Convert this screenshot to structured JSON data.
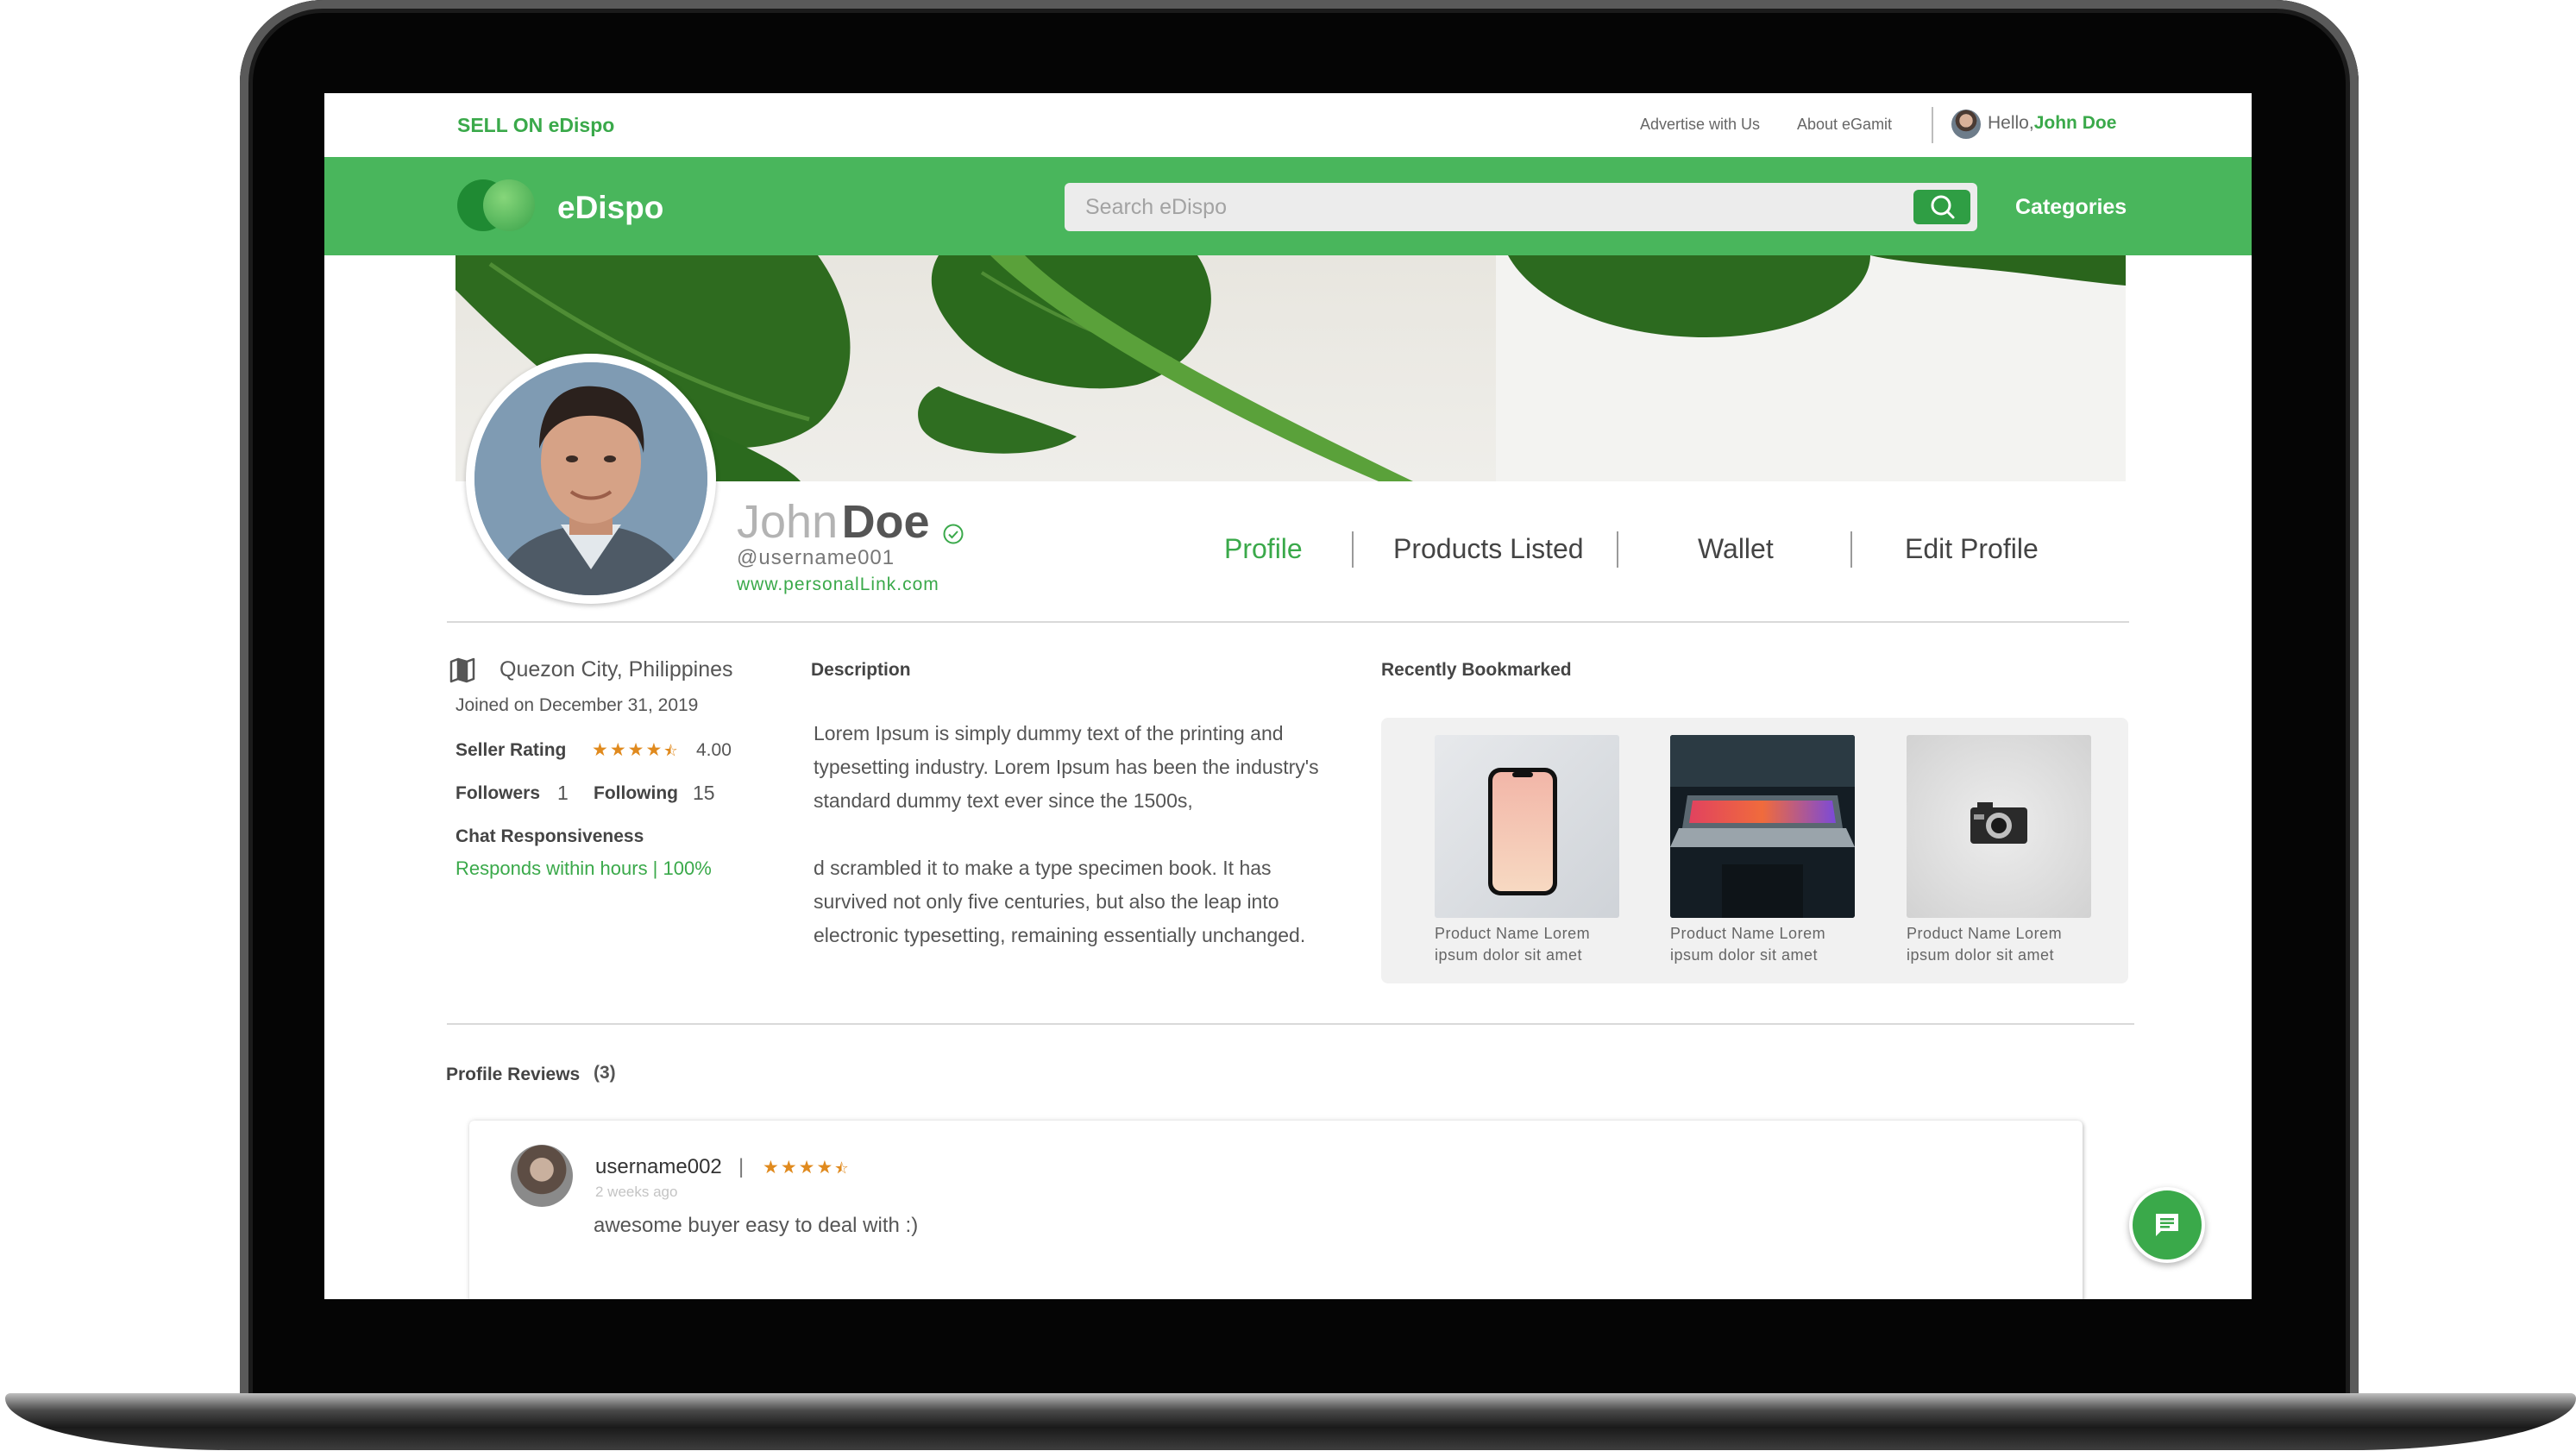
{
  "topbar": {
    "sell_link": "SELL ON eDispo",
    "advertise_link": "Advertise with Us",
    "about_link": "About eGamit",
    "greeting": "Hello,",
    "user_name": "John Doe"
  },
  "navbar": {
    "logo_text": "eDispo",
    "search_placeholder": "Search eDispo",
    "search_icon": "search-icon",
    "categories_label": "Categories"
  },
  "profile": {
    "first_name": "John",
    "last_name": "Doe",
    "username": "@username001",
    "personal_link": "www.personalLink.com",
    "verified_icon": "check-circle-icon"
  },
  "tabs": [
    {
      "label": "Profile",
      "active": true
    },
    {
      "label": "Products Listed",
      "active": false
    },
    {
      "label": "Wallet",
      "active": false
    },
    {
      "label": "Edit Profile",
      "active": false
    }
  ],
  "info": {
    "location_icon": "map-icon",
    "location": "Quezon City, Philippines",
    "joined": "Joined on December 31, 2019",
    "seller_rating_label": "Seller Rating",
    "seller_rating_stars": 4.5,
    "seller_rating_value": "4.00",
    "followers_label": "Followers",
    "followers_count": "1",
    "following_label": "Following",
    "following_count": "15",
    "chat_label": "Chat Responsiveness",
    "chat_value": "Responds within hours | 100%"
  },
  "description": {
    "title": "Description",
    "paragraph_1": "Lorem Ipsum is simply dummy text of the printing and typesetting industry. Lorem Ipsum has been the industry's standard dummy text ever since the 1500s,",
    "paragraph_2": "d scrambled it to make a type specimen book. It has survived not only five centuries, but also the leap into electronic typesetting, remaining essentially unchanged."
  },
  "bookmarks": {
    "title": "Recently Bookmarked",
    "items": [
      {
        "line1": "Product Name Lorem",
        "line2": "ipsum dolor sit amet",
        "image": "smartphone"
      },
      {
        "line1": "Product Name Lorem",
        "line2": "ipsum dolor sit amet",
        "image": "laptop"
      },
      {
        "line1": "Product Name Lorem",
        "line2": "ipsum dolor sit amet",
        "image": "camera"
      }
    ]
  },
  "reviews": {
    "title": "Profile Reviews",
    "count": "(3)",
    "items": [
      {
        "username": "username002",
        "separator": "|",
        "stars": 4.5,
        "time": "2 weeks ago",
        "text": "awesome buyer easy to deal with :)"
      }
    ]
  },
  "chat_button": {
    "icon": "chat-icon"
  },
  "colors": {
    "brand_green": "#49b65c",
    "accent_green": "#3aa94a",
    "star_orange": "#e08a1e"
  }
}
